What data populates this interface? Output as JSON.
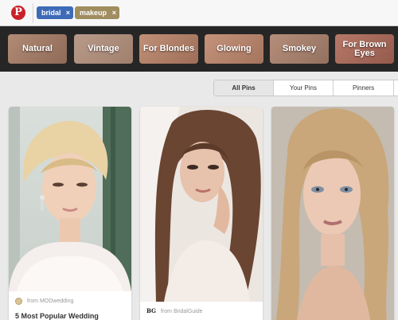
{
  "topbar": {
    "logo_glyph": "P",
    "tokens": [
      {
        "label": "bridal",
        "remove": "×"
      },
      {
        "label": "makeup",
        "remove": "×"
      }
    ],
    "input_value": ""
  },
  "guides": [
    {
      "label": "Natural"
    },
    {
      "label": "Vintage"
    },
    {
      "label": "For Blondes"
    },
    {
      "label": "Glowing"
    },
    {
      "label": "Smokey"
    },
    {
      "label": "For Brown Eyes"
    }
  ],
  "filters": {
    "tabs": [
      "All Pins",
      "Your Pins",
      "Pinners",
      ""
    ],
    "active": "All Pins"
  },
  "pins": [
    {
      "source": "from MODwedding",
      "title": "5 Most Popular Wedding"
    },
    {
      "source": "from BridalGuide",
      "source_icon_text": "BG",
      "title": ""
    },
    {
      "source": "",
      "title": ""
    }
  ],
  "colors": {
    "pinterest_red": "#cb2027",
    "bridal_token": "#3e6bb8",
    "makeup_token": "#a08d60",
    "guide_strip": "#262626"
  }
}
